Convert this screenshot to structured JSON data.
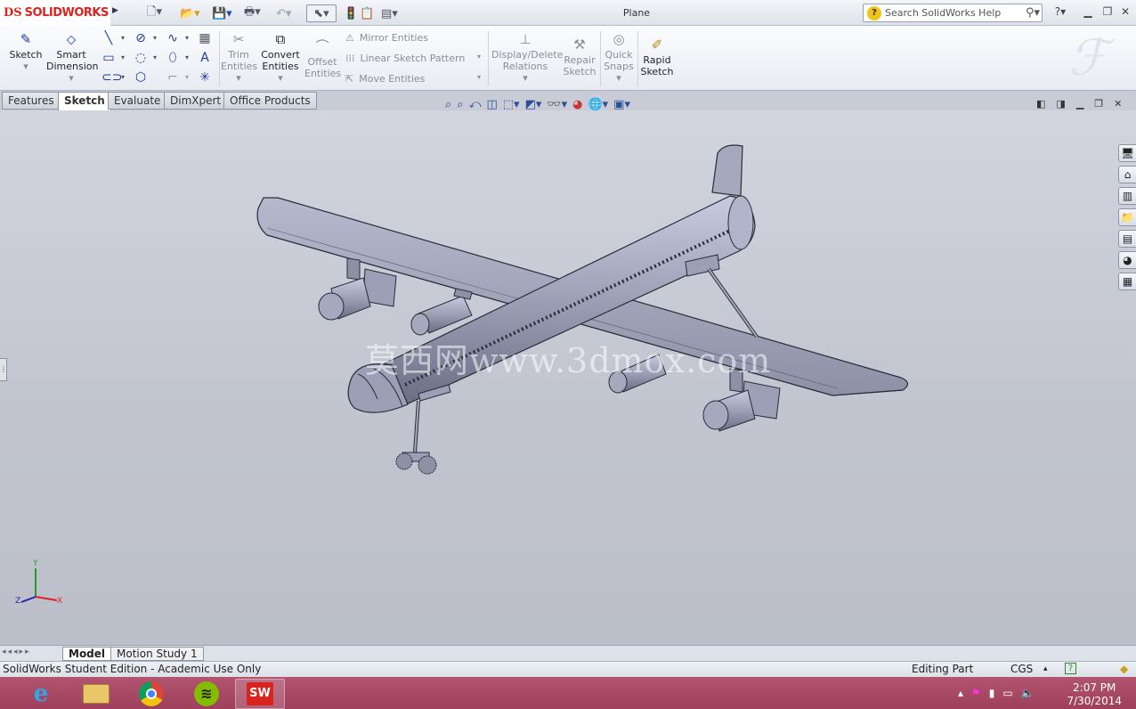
{
  "app": {
    "brand": "SOLIDWORKS",
    "document_title": "Plane",
    "search_placeholder": "Search SolidWorks Help",
    "help_label": "?"
  },
  "ribbon": {
    "sketch": "Sketch",
    "smart_dimension": [
      "Smart",
      "Dimension"
    ],
    "trim_entities": [
      "Trim",
      "Entities"
    ],
    "convert_entities": [
      "Convert",
      "Entities"
    ],
    "offset_entities": [
      "Offset",
      "Entities"
    ],
    "mirror_entities": "Mirror Entities",
    "linear_sketch_pattern": "Linear Sketch Pattern",
    "move_entities": "Move Entities",
    "display_delete_relations": [
      "Display/Delete",
      "Relations"
    ],
    "repair_sketch": [
      "Repair",
      "Sketch"
    ],
    "quick_snaps": [
      "Quick",
      "Snaps"
    ],
    "rapid_sketch": [
      "Rapid",
      "Sketch"
    ]
  },
  "tabs": [
    "Features",
    "Sketch",
    "Evaluate",
    "DimXpert",
    "Office Products"
  ],
  "active_tab": "Sketch",
  "watermark": "莫西网www.3dmox.com",
  "triad": {
    "x": "X",
    "y": "Y",
    "z": "Z"
  },
  "bottom_tabs": [
    "Model",
    "Motion Study 1"
  ],
  "status": {
    "left": "SolidWorks Student Edition - Academic Use Only",
    "mode": "Editing Part",
    "units": "CGS"
  },
  "taskbar": {
    "apps": [
      "internet-explorer-icon",
      "file-explorer-icon",
      "chrome-icon",
      "spotify-icon",
      "solidworks-icon"
    ],
    "time": "2:07 PM",
    "date": "7/30/2014"
  },
  "colors": {
    "brand_red": "#d9231e",
    "viewport": "#c9ccd7",
    "model_gray": "#9c9fb3",
    "taskbar": "#a8496a"
  }
}
